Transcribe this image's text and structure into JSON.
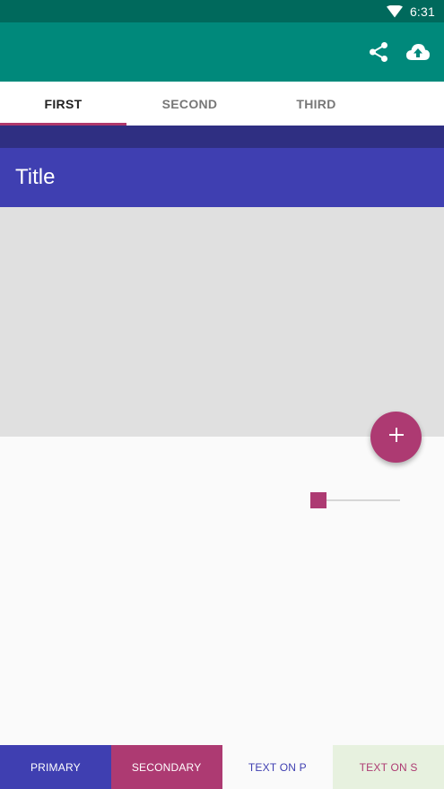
{
  "status_bar": {
    "time": "6:31",
    "wifi_icon": "wifi-icon"
  },
  "app_bar": {
    "actions": [
      {
        "icon": "share-icon"
      },
      {
        "icon": "cloud-upload-icon"
      }
    ]
  },
  "tabs": [
    {
      "label": "FIRST",
      "active": true
    },
    {
      "label": "SECOND",
      "active": false
    },
    {
      "label": "THIRD",
      "active": false
    }
  ],
  "title_bar": {
    "title": "Title"
  },
  "fab": {
    "icon": "plus-icon"
  },
  "slider": {
    "value": 0.0
  },
  "bottom_buttons": [
    {
      "label": "PRIMARY"
    },
    {
      "label": "SECONDARY"
    },
    {
      "label": "TEXT ON P"
    },
    {
      "label": "TEXT ON S"
    }
  ],
  "colors": {
    "status_bar": "#00695c",
    "app_bar": "#00897b",
    "primary": "#3f3fb1",
    "primary_dark": "#2f2f82",
    "secondary": "#ad3a72",
    "tab_indicator": "#b0386b",
    "content_gray": "#e0e0e0"
  }
}
